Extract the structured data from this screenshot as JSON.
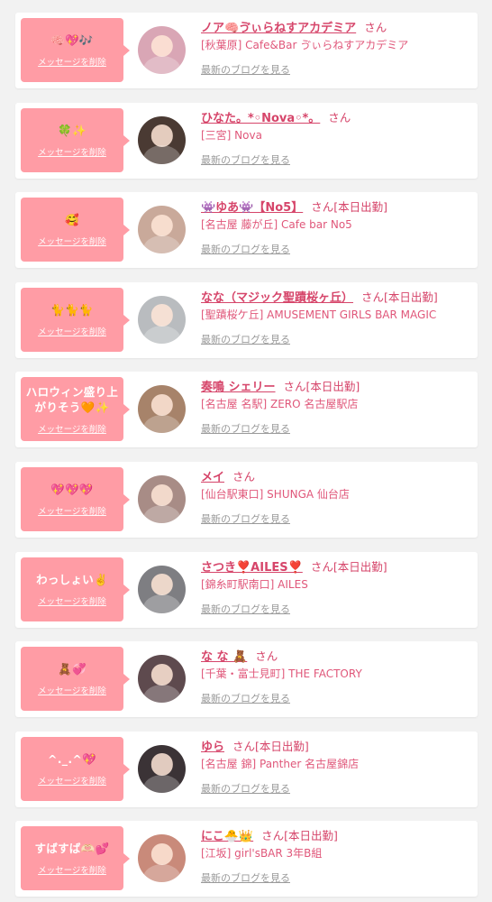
{
  "common": {
    "delete_label": "メッセージを削除",
    "san_label": "さん",
    "blog_label": "最新のブログを見る"
  },
  "colors": {
    "bubble": "#ff9ca5",
    "name": "#d6456a",
    "shop": "#e0577a"
  },
  "entries": [
    {
      "message": "🧠💖🎶",
      "name": "ノア🧠ゔぃらねすアカデミア",
      "status": "",
      "shop": "[秋葉原] Cafe&Bar ゔぃらねすアカデミア",
      "avatar_color": "#d9a6b5"
    },
    {
      "message": "🍀✨",
      "name": "ひなた。*◦Nova◦*。",
      "status": "",
      "shop": "[三宮] Nova",
      "avatar_color": "#4a3a33"
    },
    {
      "message": "🥰",
      "name": "👾ゆあ👾【No5】",
      "status": "[本日出勤]",
      "shop": "[名古屋 藤が丘] Cafe bar No5",
      "avatar_color": "#c9a99a"
    },
    {
      "message": "🐈🐈🐈",
      "name": "なな（マジック聖蹟桜ヶ丘）",
      "status": "[本日出勤]",
      "shop": "[聖蹟桜ケ丘] AMUSEMENT GIRLS BAR MAGIC",
      "avatar_color": "#b9bcbf"
    },
    {
      "message": "ハロウィン盛り上がりそう🧡✨",
      "name": "奏鳴 シェリー",
      "status": "[本日出勤]",
      "shop": "[名古屋 名駅] ZERO 名古屋駅店",
      "avatar_color": "#a7836a"
    },
    {
      "message": "💖💖💖",
      "name": "メイ",
      "status": "",
      "shop": "[仙台駅東口] SHUNGA 仙台店",
      "avatar_color": "#a88c86"
    },
    {
      "message": "わっしょい✌️",
      "name": "さつき❣️AILES❣️",
      "status": "[本日出勤]",
      "shop": "[錦糸町駅南口] AILES",
      "avatar_color": "#7e7e82"
    },
    {
      "message": "🧸💞",
      "name": "な な 🧸",
      "status": "",
      "shop": "[千葉・富士見町] THE FACTORY",
      "avatar_color": "#5e4a4e"
    },
    {
      "message": "^._.^💖",
      "name": "ゆら",
      "status": "[本日出勤]",
      "shop": "[名古屋 錦] Panther 名古屋錦店",
      "avatar_color": "#3b3336"
    },
    {
      "message": "すばすば🫶🏻💕",
      "name": "にこ🐣👑",
      "status": "[本日出勤]",
      "shop": "[江坂] girl'sBAR 3年B組",
      "avatar_color": "#c98a7a"
    }
  ]
}
